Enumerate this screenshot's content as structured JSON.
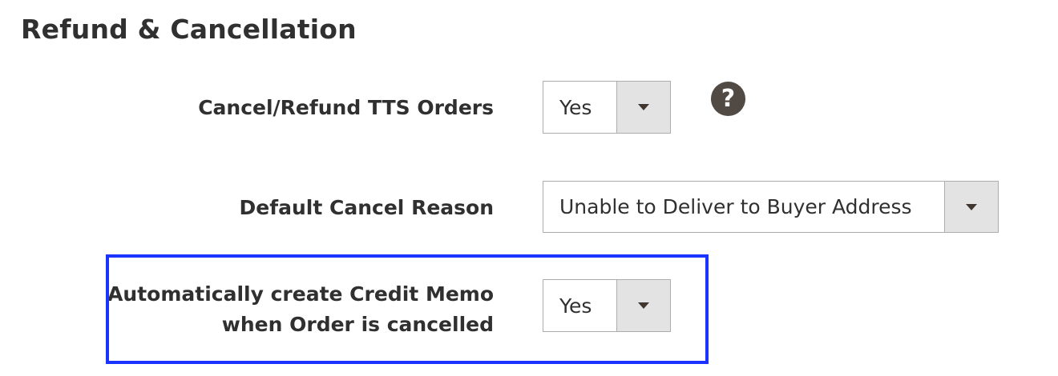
{
  "section": {
    "title": "Refund & Cancellation"
  },
  "fields": [
    {
      "label": "Cancel/Refund TTS Orders",
      "value": "Yes",
      "has_help": true,
      "help_icon": "question-circle-icon"
    },
    {
      "label": "Default Cancel Reason",
      "value": "Unable to Deliver to Buyer Address"
    },
    {
      "label_line1": "Automatically create Credit Memo",
      "label_line2": "when Order is cancelled",
      "value": "Yes",
      "highlighted": true
    }
  ],
  "icons": {
    "help": "?",
    "dropdown": "chevron-down-icon"
  },
  "colors": {
    "text": "#303030",
    "border": "#adadad",
    "arrow_bg": "#e3e3e3",
    "help_bg": "#514943",
    "highlight": "#1a33ff"
  }
}
